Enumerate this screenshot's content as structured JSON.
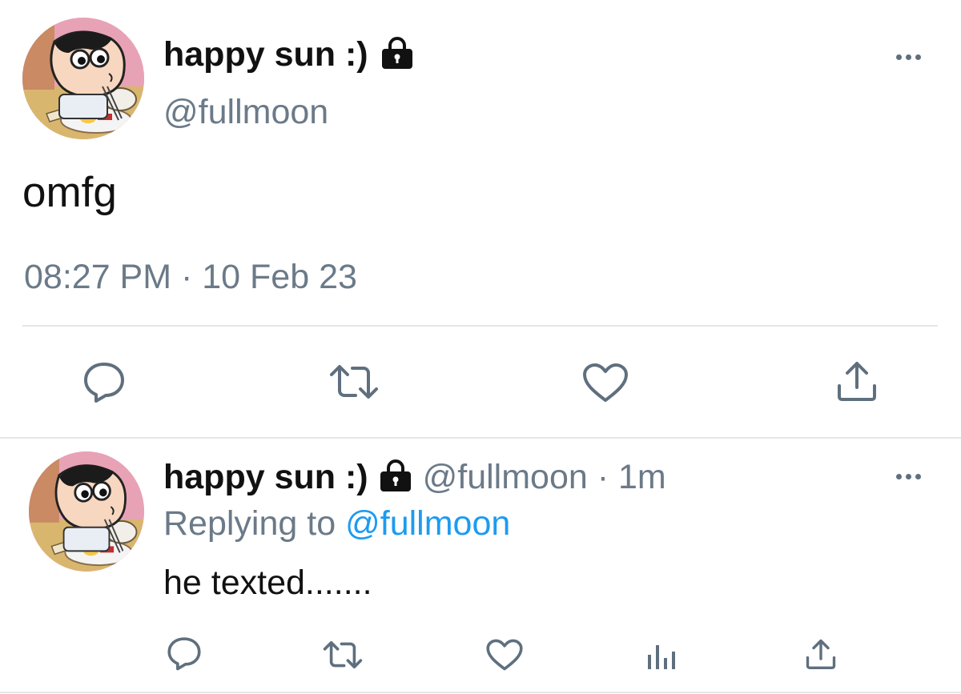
{
  "main_tweet": {
    "display_name": "happy sun :)",
    "handle": "@fullmoon",
    "text": "omfg",
    "timestamp": "08:27 PM · 10 Feb 23",
    "locked": true,
    "actions": [
      "reply-icon",
      "retweet-icon",
      "like-icon",
      "share-icon"
    ]
  },
  "reply_tweet": {
    "display_name": "happy sun :)",
    "meta": "@fullmoon · 1m",
    "replying_prefix": "Replying to",
    "replying_handle": "@fullmoon",
    "text": "he texted.......",
    "locked": true,
    "actions": [
      "reply-icon",
      "retweet-icon",
      "like-icon",
      "analytics-icon",
      "share-icon"
    ]
  },
  "colors": {
    "text": "#111111",
    "muted": "#6b7a88",
    "link": "#1d9bf0",
    "icon": "#5f6f7e",
    "divider": "#e3e7ea"
  }
}
